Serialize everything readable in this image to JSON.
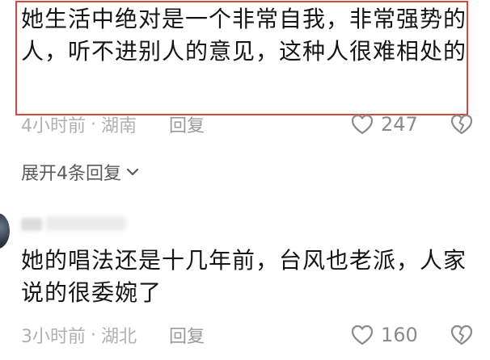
{
  "comments": [
    {
      "text": "她生活中绝对是一个非常自我，非常强势的人，听不进别人的意见，这种人很难相处的",
      "time": "4小时前",
      "location": "湖南",
      "separator": "·",
      "reply_label": "回复",
      "likes": "247",
      "highlighted": true
    },
    {
      "text": "她的唱法还是十几年前，台风也老派，人家说的很委婉了",
      "time": "3小时前",
      "location": "湖北",
      "separator": "·",
      "reply_label": "回复",
      "likes": "160",
      "highlighted": false
    }
  ],
  "expand_replies_label": "展开4条回复",
  "colors": {
    "highlight_border": "#d9453b",
    "text": "#151515",
    "meta": "#b0b0b0"
  },
  "icons": {
    "like": "heart-outline-icon",
    "dislike": "broken-heart-icon",
    "expand": "chevron-down-icon"
  }
}
